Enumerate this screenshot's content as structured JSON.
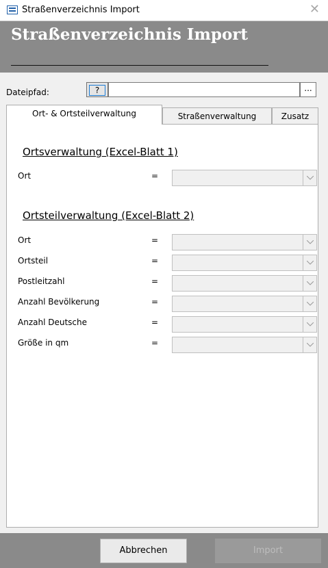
{
  "window": {
    "title": "Straßenverzeichnis Import"
  },
  "header": {
    "title": "Straßenverzeichnis Import"
  },
  "path": {
    "label": "Dateipfad:",
    "help_button": "?",
    "value": "",
    "browse_button": "..."
  },
  "tabs": [
    {
      "label": "Ort- & Ortsteilverwaltung",
      "active": true
    },
    {
      "label": "Straßenverwaltung",
      "active": false
    },
    {
      "label": "Zusatz",
      "active": false
    }
  ],
  "ortsverwaltung": {
    "heading": "Ortsverwaltung (Excel-Blatt 1)",
    "fields": [
      {
        "label": "Ort",
        "eq": "="
      }
    ]
  },
  "ortsteilverwaltung": {
    "heading": "Ortsteilverwaltung (Excel-Blatt 2)",
    "fields": [
      {
        "label": "Ort",
        "eq": "="
      },
      {
        "label": "Ortsteil",
        "eq": "="
      },
      {
        "label": "Postleitzahl",
        "eq": "="
      },
      {
        "label": "Anzahl Bevölkerung",
        "eq": "="
      },
      {
        "label": "Anzahl Deutsche",
        "eq": "="
      },
      {
        "label": "Größe in qm",
        "eq": "="
      }
    ]
  },
  "footer": {
    "cancel": "Abbrechen",
    "import": "Import"
  }
}
